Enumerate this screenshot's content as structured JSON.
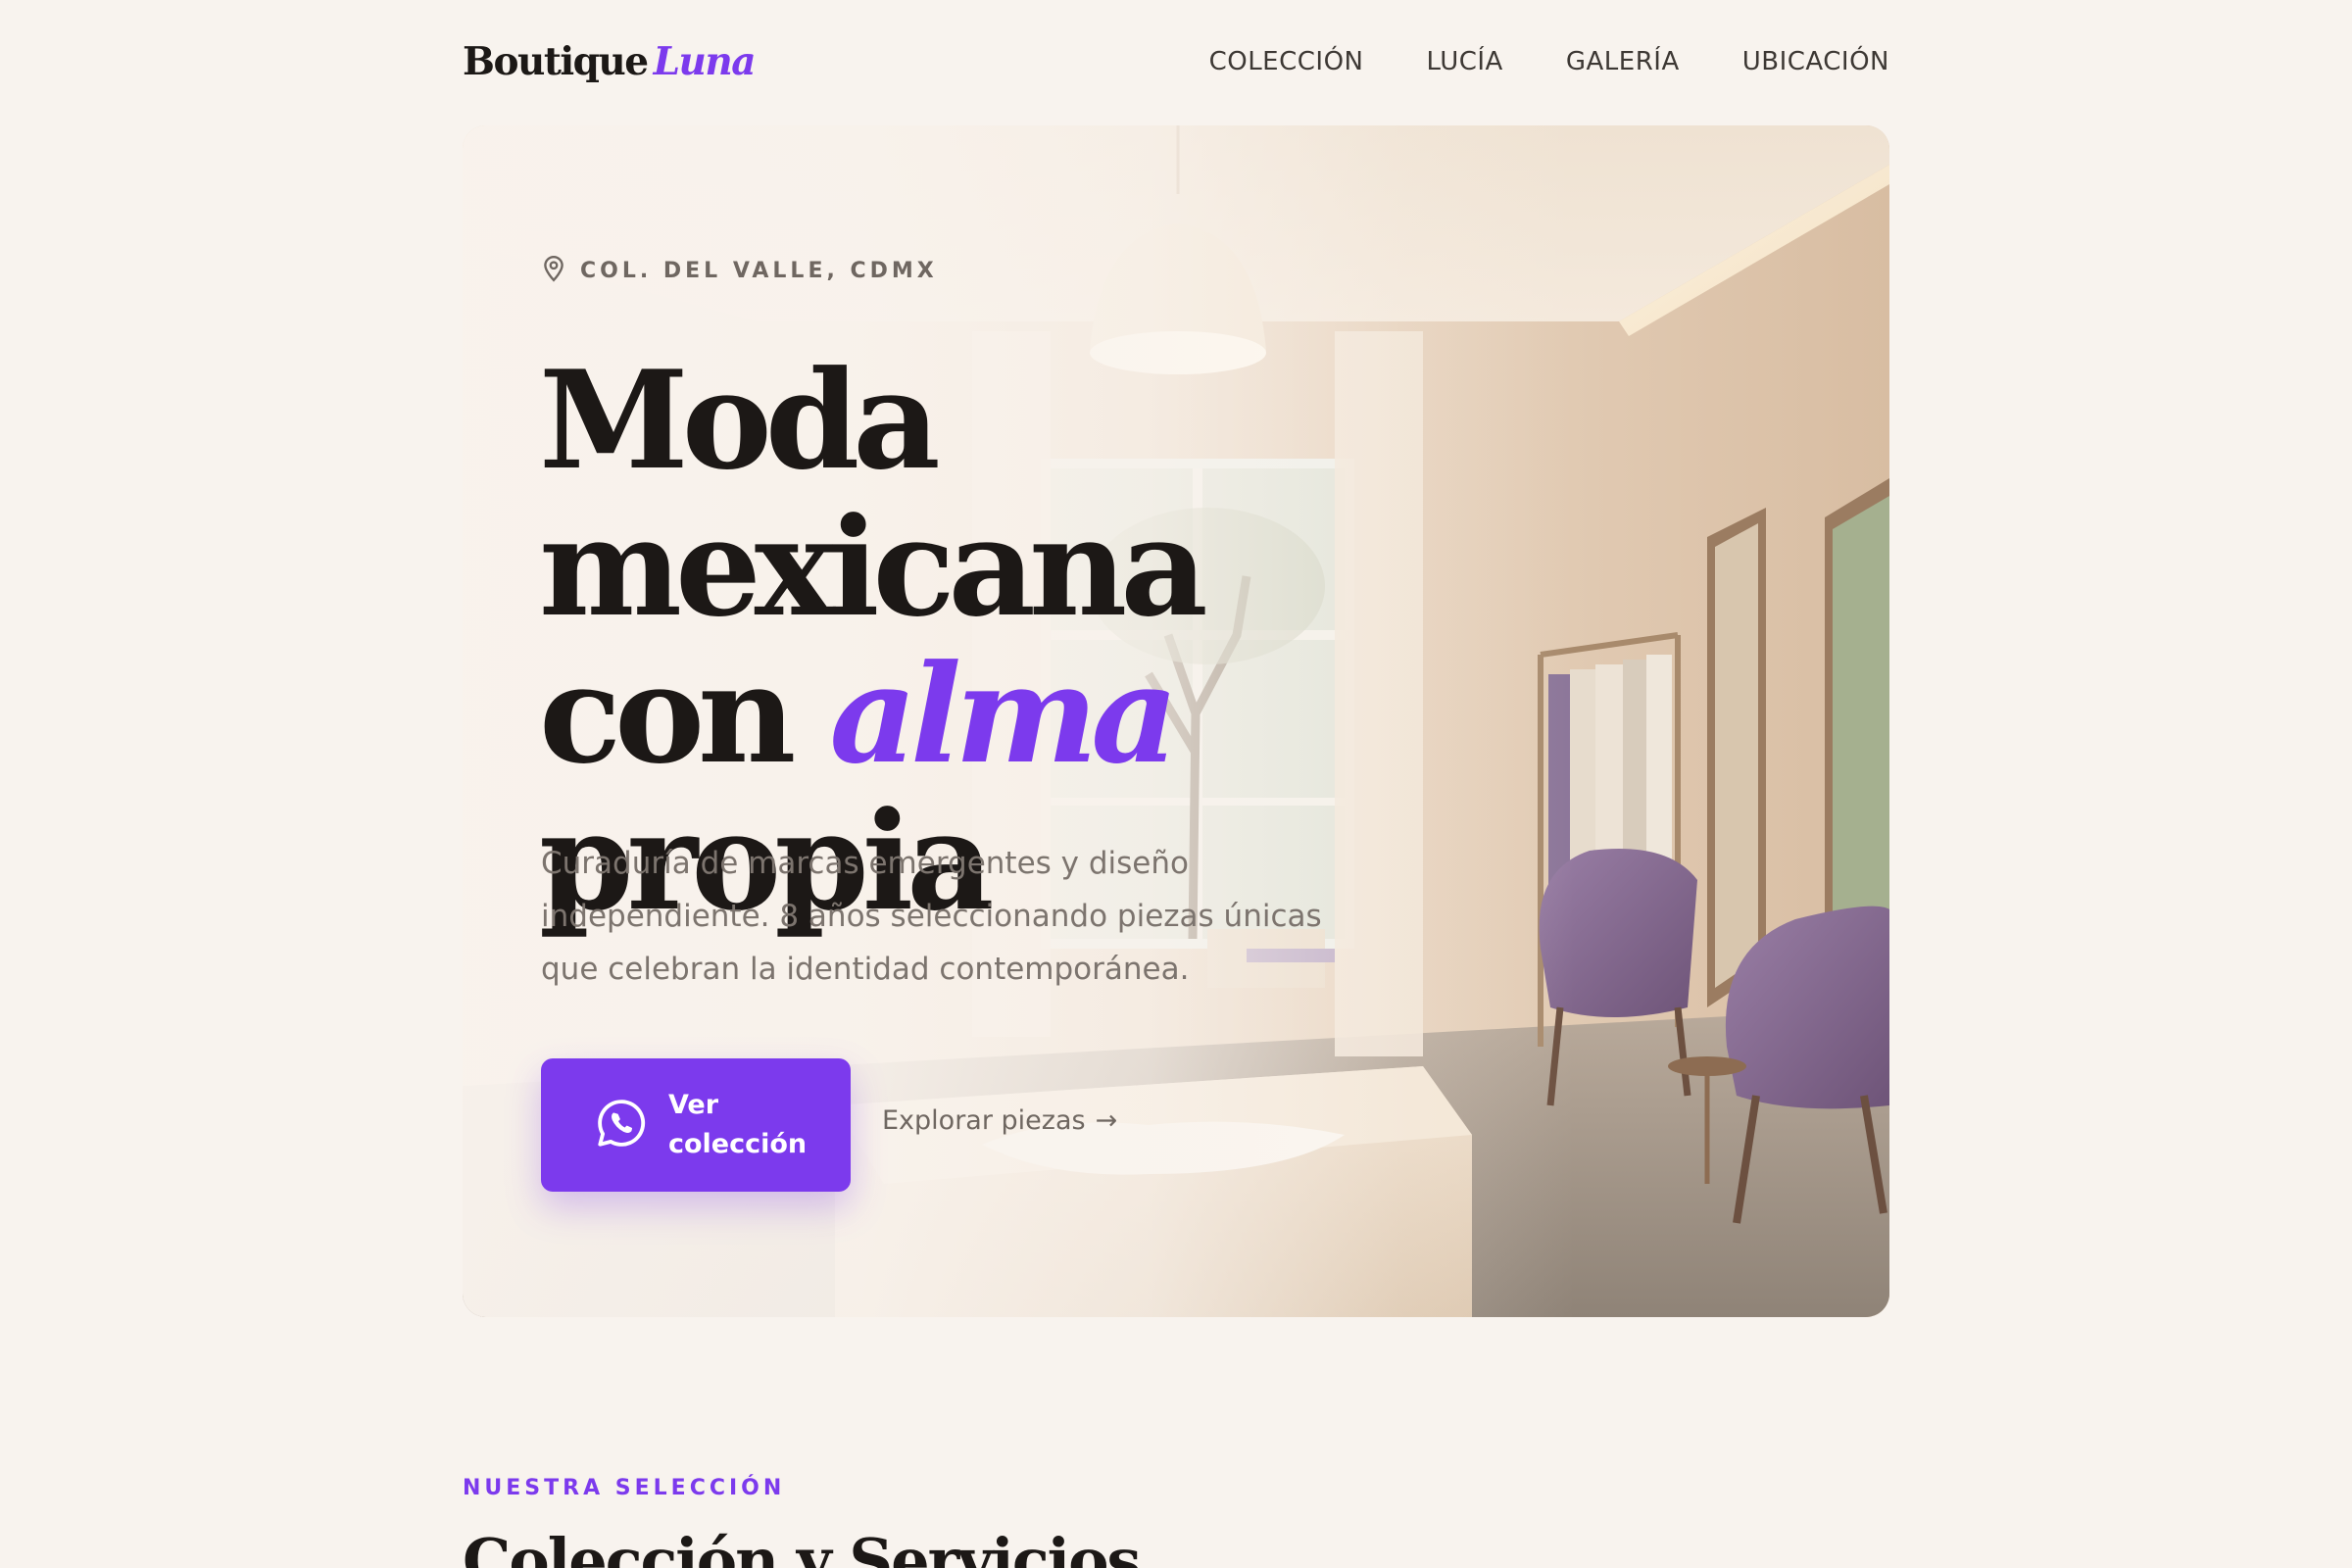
{
  "brand": {
    "name": "Boutique",
    "accent": "Luna",
    "accent_color": "#7c3aed"
  },
  "nav": {
    "items": [
      {
        "label": "COLECCIÓN"
      },
      {
        "label": "LUCÍA"
      },
      {
        "label": "GALERÍA"
      },
      {
        "label": "UBICACIÓN"
      }
    ]
  },
  "hero": {
    "location_icon": "map-pin-icon",
    "location": "COL. DEL VALLE, CDMX",
    "headline": {
      "line1": "Moda mexicana",
      "line2_prefix": "con",
      "line2_accent": "alma",
      "line3": "propia"
    },
    "subtext": "Curaduría de marcas emergentes y diseño independiente. 8 años seleccionando piezas únicas que celebran la identidad contemporánea.",
    "cta": {
      "icon": "whatsapp-icon",
      "label": "Ver colección"
    },
    "secondary_link": {
      "label": "Explorar piezas",
      "arrow": "→"
    }
  },
  "section": {
    "eyebrow": "NUESTRA SELECCIÓN",
    "title": "Colección y Servicios"
  },
  "colors": {
    "background": "#f8f3ee",
    "text": "#1c1816",
    "muted": "#7c746e",
    "accent": "#7c3aed"
  }
}
